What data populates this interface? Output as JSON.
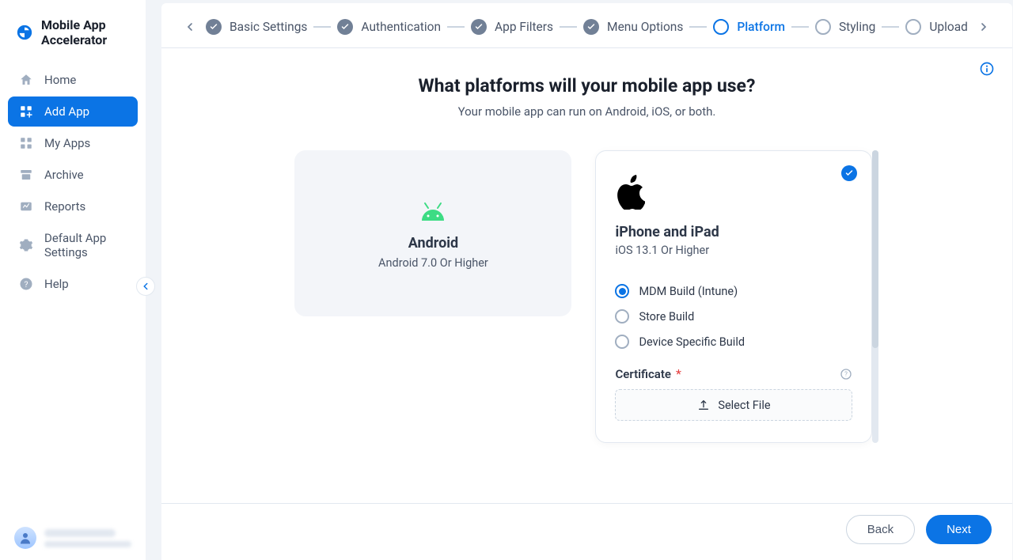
{
  "brand": {
    "title": "Mobile App Accelerator"
  },
  "sidebar": {
    "items": [
      {
        "label": "Home"
      },
      {
        "label": "Add App"
      },
      {
        "label": "My Apps"
      },
      {
        "label": "Archive"
      },
      {
        "label": "Reports"
      },
      {
        "label": "Default App Settings"
      },
      {
        "label": "Help"
      }
    ],
    "active_index": 1
  },
  "stepper": {
    "steps": [
      {
        "label": "Basic Settings",
        "state": "done"
      },
      {
        "label": "Authentication",
        "state": "done"
      },
      {
        "label": "App Filters",
        "state": "done"
      },
      {
        "label": "Menu Options",
        "state": "done"
      },
      {
        "label": "Platform",
        "state": "active"
      },
      {
        "label": "Styling",
        "state": "future"
      },
      {
        "label": "Upload",
        "state": "future"
      }
    ]
  },
  "page": {
    "title": "What platforms will your mobile app use?",
    "subtitle": "Your mobile app can run on Android, iOS, or both."
  },
  "platforms": {
    "android": {
      "title": "Android",
      "subtitle": "Android 7.0 Or Higher",
      "selected": false
    },
    "ios": {
      "title": "iPhone and iPad",
      "subtitle": "iOS 13.1 Or Higher",
      "selected": true,
      "build_options": [
        {
          "label": "MDM Build (Intune)",
          "selected": true
        },
        {
          "label": "Store Build",
          "selected": false
        },
        {
          "label": "Device Specific Build",
          "selected": false
        }
      ],
      "certificate_label": "Certificate",
      "select_file_label": "Select File"
    }
  },
  "footer": {
    "back": "Back",
    "next": "Next"
  },
  "colors": {
    "primary": "#0b74e5"
  }
}
